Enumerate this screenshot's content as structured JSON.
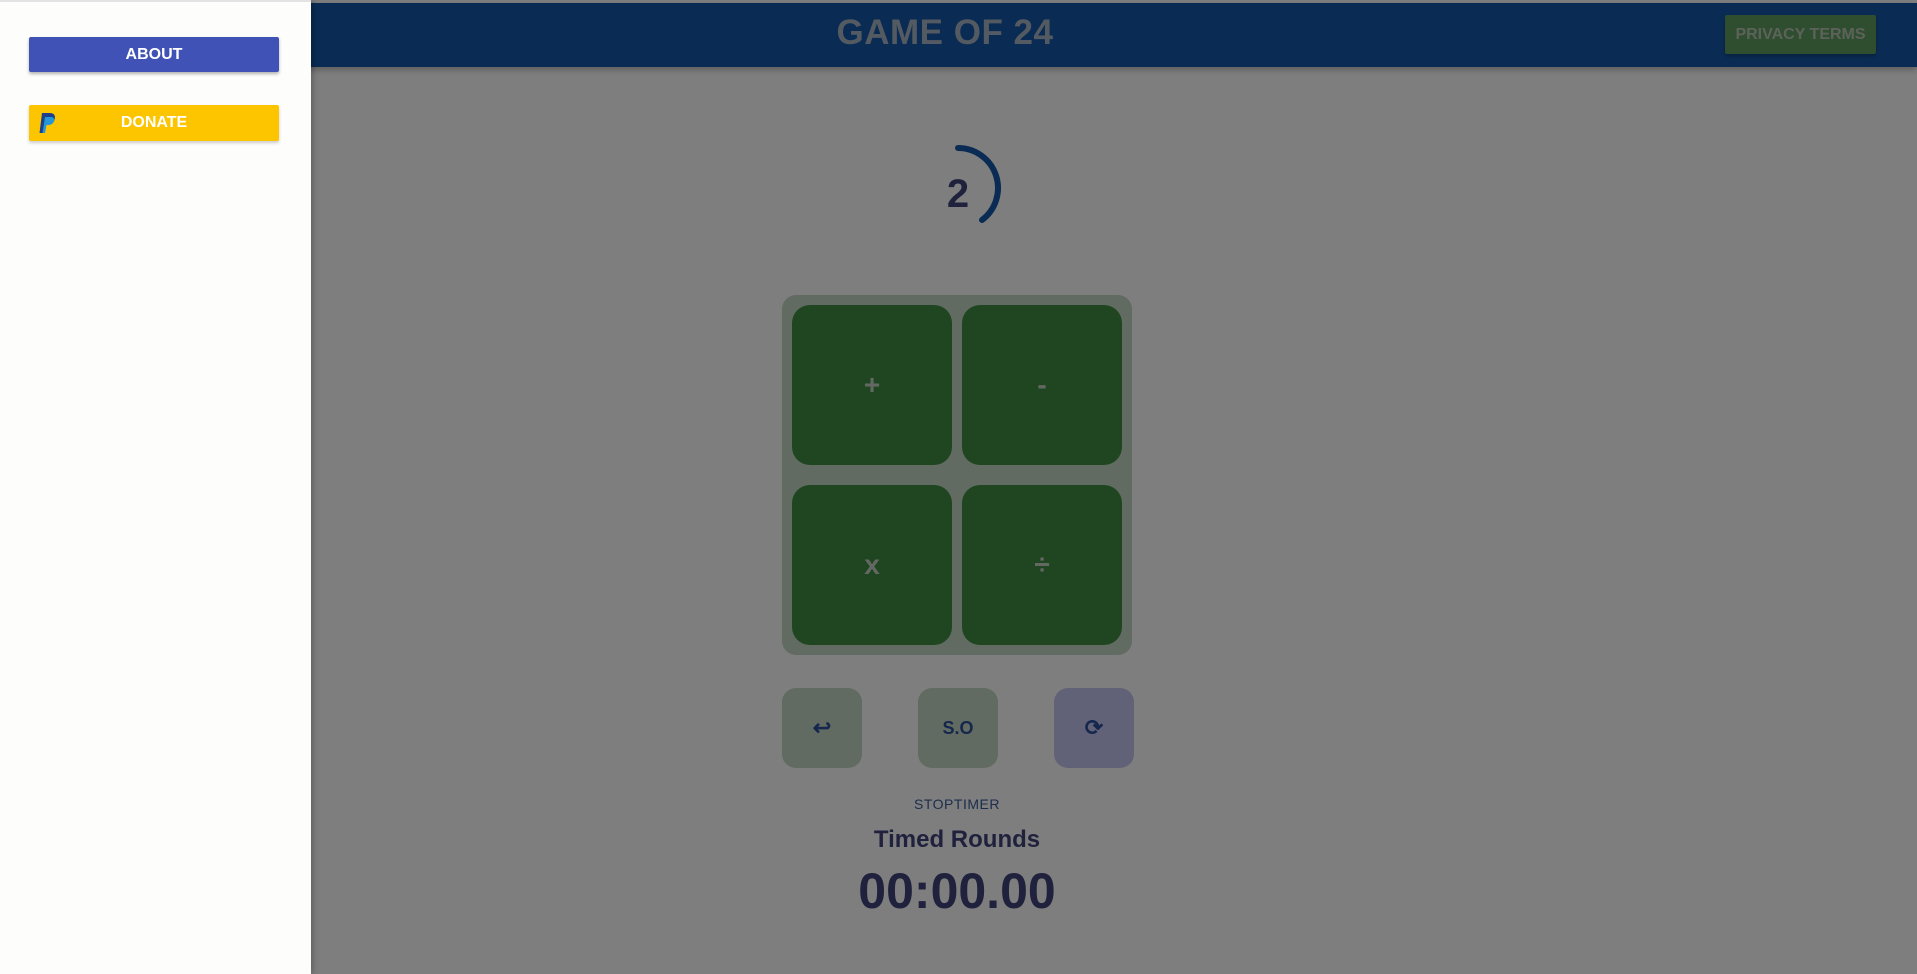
{
  "header": {
    "title": "GAME OF 24",
    "privacy_label": "PRIVACY TERMS"
  },
  "timer": {
    "value": "2"
  },
  "operators": [
    {
      "label": "+"
    },
    {
      "label": "-"
    },
    {
      "label": "x"
    },
    {
      "label": "÷"
    }
  ],
  "controls": {
    "undo_icon": "↩",
    "solve_label": "S.O",
    "refresh_icon": "⟳"
  },
  "footer": {
    "stoptimer_label": "STOPTIMER",
    "mode_label": "Timed Rounds",
    "clock": "00:00.00"
  },
  "drawer": {
    "about_label": "ABOUT",
    "donate_label": "DONATE"
  },
  "colors": {
    "header_bg": "#1557a6",
    "operator_bg": "#3f8c41",
    "about_bg": "#4152b6",
    "donate_bg": "#fdc400",
    "accent_text": "#40457a"
  }
}
